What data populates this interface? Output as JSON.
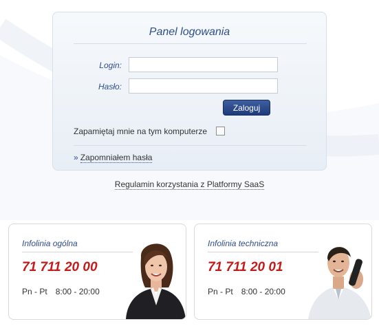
{
  "login_panel": {
    "title": "Panel logowania",
    "login_label": "Login:",
    "login_value": "",
    "password_label": "Hasło:",
    "password_value": "",
    "submit_label": "Zaloguj",
    "remember_label": "Zapamiętaj mnie na tym komputerze",
    "remember_checked": false,
    "forgot_arrow": "»",
    "forgot_label": "Zapomniałem hasła"
  },
  "terms_link": "Regulamin korzystania z Platformy SaaS",
  "contacts": [
    {
      "title": "Infolinia ogólna",
      "phone": "71 711 20 00",
      "days": "Pn - Pt",
      "hours": "8:00 - 20:00",
      "photo": "woman-consultant-photo"
    },
    {
      "title": "Infolinia techniczna",
      "phone": "71 711 20 01",
      "days": "Pn - Pt",
      "hours": "8:00 - 20:00",
      "photo": "man-on-phone-photo"
    }
  ],
  "colors": {
    "accent_blue": "#2f4d8d",
    "button_blue": "#1f3a79",
    "phone_red": "#c41a1a"
  }
}
